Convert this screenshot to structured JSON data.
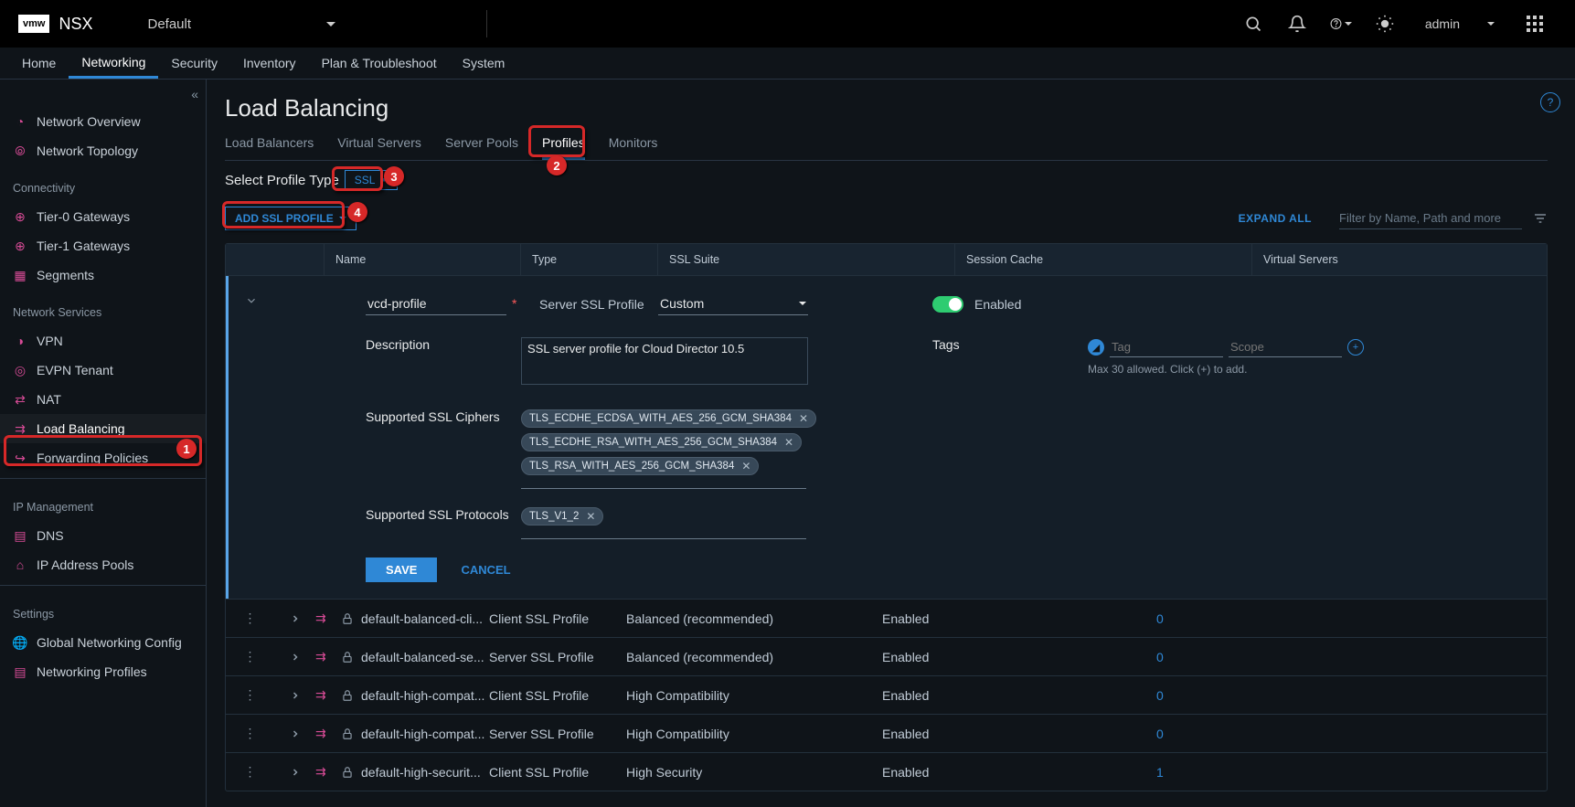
{
  "top": {
    "logo": "vmw",
    "brand": "NSX",
    "selector": "Default",
    "user": "admin"
  },
  "main_tabs": [
    "Home",
    "Networking",
    "Security",
    "Inventory",
    "Plan & Troubleshoot",
    "System"
  ],
  "active_main_tab": "Networking",
  "side_nav": {
    "overview": [
      "Network Overview",
      "Network Topology"
    ],
    "connectivity_header": "Connectivity",
    "connectivity": [
      "Tier-0 Gateways",
      "Tier-1 Gateways",
      "Segments"
    ],
    "services_header": "Network Services",
    "services": [
      "VPN",
      "EVPN Tenant",
      "NAT",
      "Load Balancing",
      "Forwarding Policies"
    ],
    "ip_header": "IP Management",
    "ip": [
      "DNS",
      "IP Address Pools"
    ],
    "settings_header": "Settings",
    "settings": [
      "Global Networking Config",
      "Networking Profiles"
    ]
  },
  "page": {
    "title": "Load Balancing",
    "sub_tabs": [
      "Load Balancers",
      "Virtual Servers",
      "Server Pools",
      "Profiles",
      "Monitors"
    ],
    "active_sub_tab": "Profiles",
    "profile_type_label": "Select Profile Type",
    "profile_type_value": "SSL",
    "add_profile_label": "ADD SSL PROFILE",
    "expand_all": "EXPAND ALL",
    "filter_placeholder": "Filter by Name, Path and more"
  },
  "table_headers": {
    "name": "Name",
    "type": "Type",
    "suite": "SSL Suite",
    "cache": "Session Cache",
    "vs": "Virtual Servers"
  },
  "edit": {
    "name": "vcd-profile",
    "type_label": "Server SSL Profile",
    "suite_value": "Custom",
    "cache_status": "Enabled",
    "description_label": "Description",
    "description_value": "SSL server profile for Cloud Director 10.5",
    "tags_label": "Tags",
    "tag_placeholder": "Tag",
    "scope_placeholder": "Scope",
    "tags_hint": "Max 30 allowed. Click (+) to add.",
    "ciphers_label": "Supported SSL Ciphers",
    "ciphers": [
      "TLS_ECDHE_ECDSA_WITH_AES_256_GCM_SHA384",
      "TLS_ECDHE_RSA_WITH_AES_256_GCM_SHA384",
      "TLS_RSA_WITH_AES_256_GCM_SHA384"
    ],
    "protocols_label": "Supported SSL Protocols",
    "protocols": [
      "TLS_V1_2"
    ],
    "save": "SAVE",
    "cancel": "CANCEL"
  },
  "rows": [
    {
      "name": "default-balanced-cli...",
      "type": "Client SSL Profile",
      "suite": "Balanced (recommended)",
      "cache": "Enabled",
      "vs": "0"
    },
    {
      "name": "default-balanced-se...",
      "type": "Server SSL Profile",
      "suite": "Balanced (recommended)",
      "cache": "Enabled",
      "vs": "0"
    },
    {
      "name": "default-high-compat...",
      "type": "Client SSL Profile",
      "suite": "High Compatibility",
      "cache": "Enabled",
      "vs": "0"
    },
    {
      "name": "default-high-compat...",
      "type": "Server SSL Profile",
      "suite": "High Compatibility",
      "cache": "Enabled",
      "vs": "0"
    },
    {
      "name": "default-high-securit...",
      "type": "Client SSL Profile",
      "suite": "High Security",
      "cache": "Enabled",
      "vs": "1"
    }
  ],
  "annotations": {
    "1": "1",
    "2": "2",
    "3": "3",
    "4": "4"
  }
}
